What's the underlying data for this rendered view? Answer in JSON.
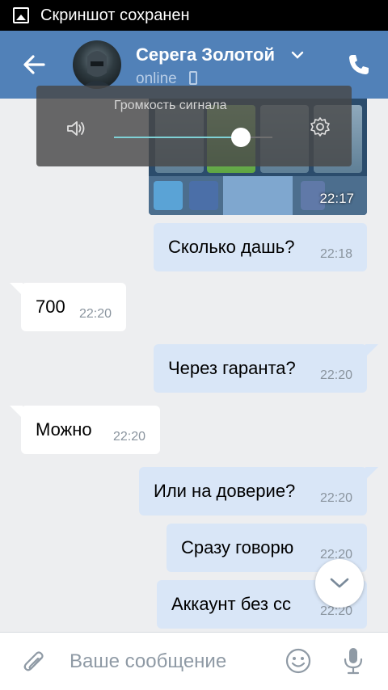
{
  "status_bar": {
    "notification_text": "Скриншот сохранен"
  },
  "header": {
    "contact_name": "Серега Золотой",
    "contact_status": "online",
    "accent_color": "#5181b8"
  },
  "messages": [
    {
      "type": "image",
      "direction": "out",
      "time": "22:17"
    },
    {
      "direction": "out",
      "text": "Сколько дашь?",
      "time": "22:18"
    },
    {
      "direction": "in",
      "text": "700",
      "time": "22:20"
    },
    {
      "direction": "out",
      "text": "Через гаранта?",
      "time": "22:20"
    },
    {
      "direction": "in",
      "text": "Можно",
      "time": "22:20"
    },
    {
      "direction": "out",
      "text": "Или на доверие?",
      "time": "22:20"
    },
    {
      "direction": "out",
      "text": "Сразу говорю",
      "time": "22:20"
    },
    {
      "direction": "out",
      "text": "Аккаунт без сс",
      "time": "22:20"
    }
  ],
  "volume_overlay": {
    "title": "Громкость сигнала",
    "level": 0.8
  },
  "composer": {
    "placeholder": "Ваше сообщение"
  },
  "icons": [
    "back-arrow-icon",
    "chevron-down-icon",
    "mobile-device-icon",
    "phone-icon",
    "speaker-icon",
    "gear-icon",
    "chevron-down-icon",
    "paperclip-icon",
    "emoji-icon",
    "microphone-icon"
  ]
}
